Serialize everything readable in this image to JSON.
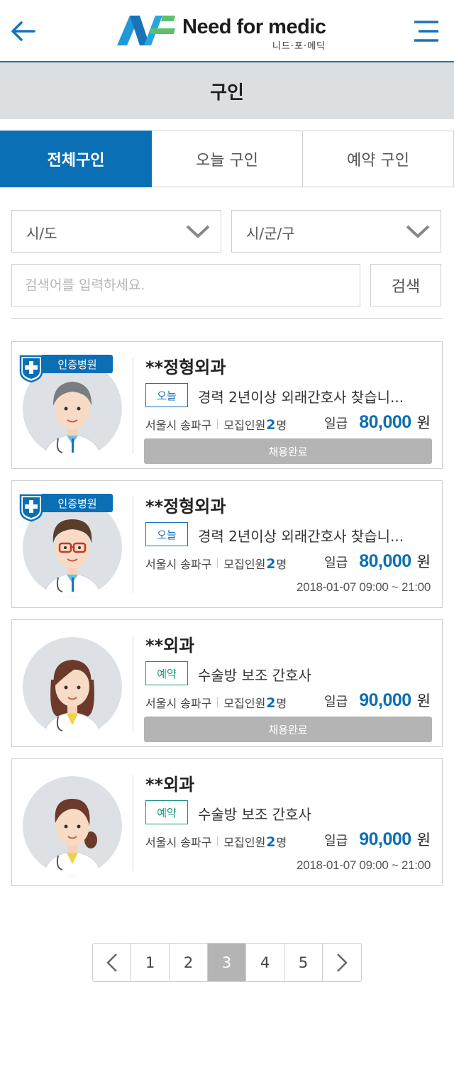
{
  "header": {
    "brand": "Need for medic",
    "brand_sub": "니드·포·메딕"
  },
  "page_title": "구인",
  "tabs": [
    {
      "label": "전체구인",
      "active": true
    },
    {
      "label": "오늘 구인",
      "active": false
    },
    {
      "label": "예약 구인",
      "active": false
    }
  ],
  "filters": {
    "region_select": "시/도",
    "district_select": "시/군/구",
    "search_placeholder": "검색어를 입력하세요.",
    "search_button": "검색"
  },
  "cards": [
    {
      "certified": true,
      "cert_label": "인증병원",
      "name": "**정형외과",
      "tag": "오늘",
      "title": "경력 2년이상 외래간호사 찾습니...",
      "location": "서울시 송파구",
      "recruit_label": "모집인원",
      "recruit_count": "2",
      "recruit_unit": "명",
      "pay_label": "일급",
      "pay_amount": "80,000",
      "pay_unit": "원",
      "status": "채용완료",
      "datetime": ""
    },
    {
      "certified": true,
      "cert_label": "인증병원",
      "name": "**정형외과",
      "tag": "오늘",
      "title": "경력 2년이상 외래간호사 찾습니...",
      "location": "서울시 송파구",
      "recruit_label": "모집인원",
      "recruit_count": "2",
      "recruit_unit": "명",
      "pay_label": "일급",
      "pay_amount": "80,000",
      "pay_unit": "원",
      "status": "",
      "datetime": "2018-01-07  09:00 ~ 21:00"
    },
    {
      "certified": false,
      "cert_label": "",
      "name": "**외과",
      "tag": "예약",
      "title": "수술방 보조 간호사",
      "location": "서울시 송파구",
      "recruit_label": "모집인원",
      "recruit_count": "2",
      "recruit_unit": "명",
      "pay_label": "일급",
      "pay_amount": "90,000",
      "pay_unit": "원",
      "status": "채용완료",
      "datetime": ""
    },
    {
      "certified": false,
      "cert_label": "",
      "name": "**외과",
      "tag": "예약",
      "title": "수술방 보조 간호사",
      "location": "서울시 송파구",
      "recruit_label": "모집인원",
      "recruit_count": "2",
      "recruit_unit": "명",
      "pay_label": "일급",
      "pay_amount": "90,000",
      "pay_unit": "원",
      "status": "",
      "datetime": "2018-01-07  09:00 ~ 21:00"
    }
  ],
  "pagination": {
    "pages": [
      "1",
      "2",
      "3",
      "4",
      "5"
    ],
    "current": "3"
  },
  "colors": {
    "accent": "#0b6fb5",
    "today_tag": "#1a73b8",
    "reserve_tag": "#17937a",
    "completed": "#b4b4b4"
  }
}
